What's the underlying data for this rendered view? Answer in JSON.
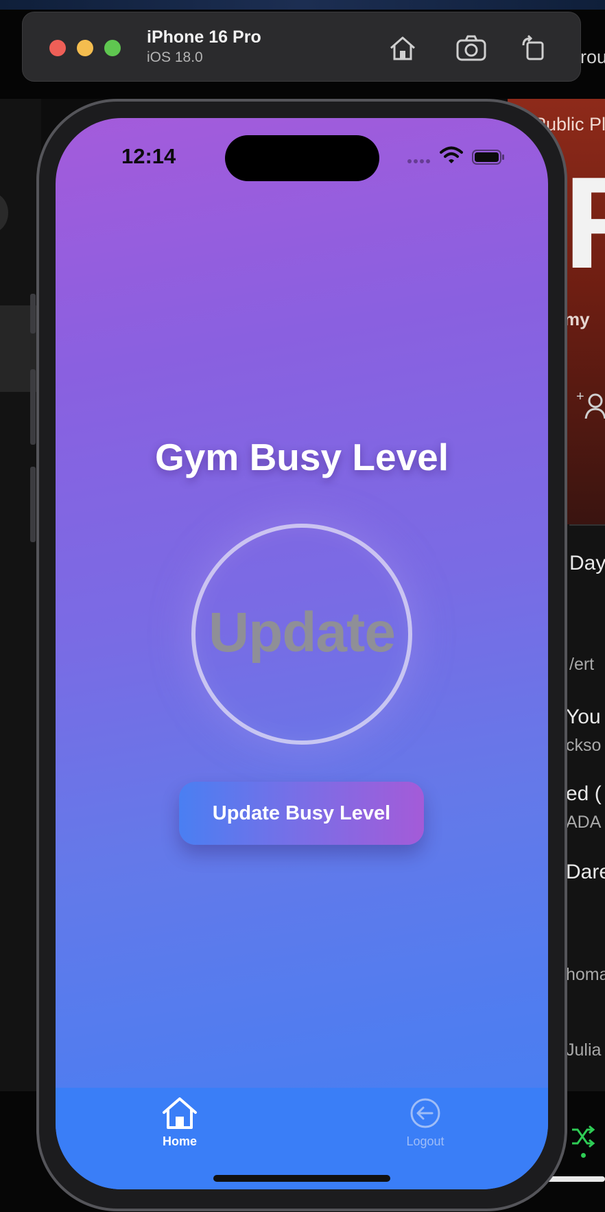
{
  "simulator": {
    "device_name": "iPhone 16 Pro",
    "os_version": "iOS 18.0",
    "buttons": {
      "home_icon": "house-icon",
      "screenshot_icon": "camera-icon",
      "rotate_icon": "rotate-icon"
    }
  },
  "status_bar": {
    "time": "12:14"
  },
  "main": {
    "title": "Gym Busy Level",
    "circle_text": "Update",
    "update_button_label": "Update Busy Level"
  },
  "tab_bar": {
    "items": [
      {
        "label": "Home",
        "icon": "home-icon",
        "active": true
      },
      {
        "label": "Logout",
        "icon": "logout-arrow-icon",
        "active": false
      }
    ]
  },
  "background_window": {
    "header_text": "Public Pl",
    "big_letter": "R",
    "subtitle_fragment": "my",
    "partial_labels": [
      "Day",
      "/ert",
      "You",
      "ckso",
      "ed (",
      "ADA",
      "Dare",
      "homa",
      "Julia"
    ],
    "top_right_fragment": "rou"
  },
  "colors": {
    "gradient_top": "#a45bdb",
    "gradient_bottom": "#447ff3",
    "tab_bar": "#3a7ef7",
    "button_start": "#4a7ff2",
    "button_end": "#a45bd8"
  }
}
